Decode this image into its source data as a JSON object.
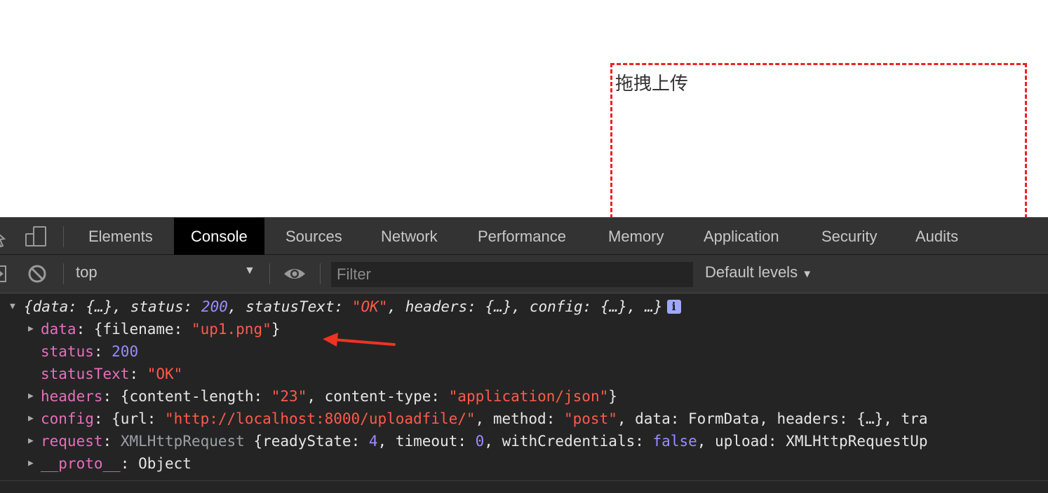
{
  "page": {
    "drop_zone_label": "拖拽上传"
  },
  "devtools": {
    "tabs": [
      "Elements",
      "Console",
      "Sources",
      "Network",
      "Performance",
      "Memory",
      "Application",
      "Security",
      "Audits"
    ],
    "active_tab": "Console",
    "toolbar": {
      "context": "top",
      "filter_placeholder": "Filter",
      "levels_label": "Default levels"
    },
    "console": {
      "summary": {
        "open": "{",
        "k_data": "data",
        "v_data": "{…}",
        "k_status": "status",
        "v_status": "200",
        "k_statusText": "statusText",
        "v_statusText": "\"OK\"",
        "k_headers": "headers",
        "v_headers": "{…}",
        "k_config": "config",
        "v_config": "{…}",
        "tail": "…}",
        "info": "i"
      },
      "data_row": {
        "key": "data",
        "prefix": "{filename: ",
        "value": "\"up1.png\"",
        "suffix": "}"
      },
      "status_row": {
        "key": "status",
        "value": "200"
      },
      "statusText_row": {
        "key": "statusText",
        "value": "\"OK\""
      },
      "headers_row": {
        "key": "headers",
        "k1": "content-length",
        "v1": "\"23\"",
        "k2": "content-type",
        "v2": "\"application/json\""
      },
      "config_row": {
        "key": "config",
        "k1": "url",
        "v1": "\"http://localhost:8000/uploadfile/\"",
        "k2": "method",
        "v2": "\"post\"",
        "k3": "data",
        "v3": "FormData",
        "k4": "headers",
        "v4": "{…}",
        "k5": "tra"
      },
      "request_row": {
        "key": "request",
        "cls": "XMLHttpRequest",
        "k1": "readyState",
        "v1": "4",
        "k2": "timeout",
        "v2": "0",
        "k3": "withCredentials",
        "v3": "false",
        "k4": "upload",
        "v4": "XMLHttpRequestUp"
      },
      "proto_row": {
        "key": "__proto__",
        "value": "Object"
      }
    }
  },
  "colors": {
    "drop_border": "#ee2222",
    "annotation_arrow": "#ee3322",
    "devtools_bg": "#242424",
    "tabbar_bg": "#333333"
  }
}
